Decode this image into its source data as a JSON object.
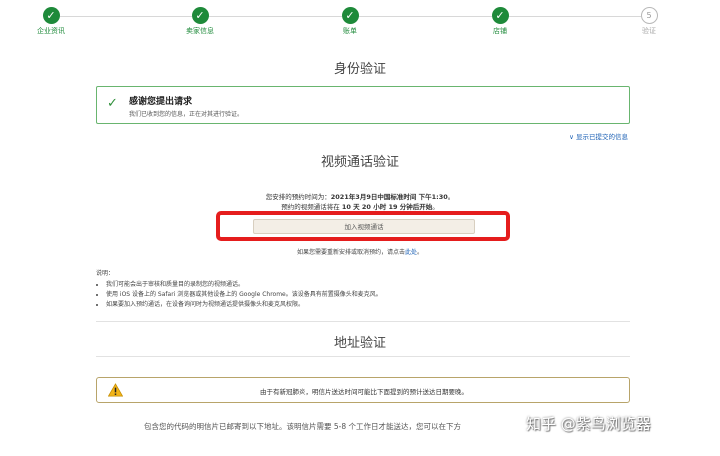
{
  "steps": [
    {
      "label": "企业资讯",
      "done": true,
      "icon": "check-icon"
    },
    {
      "label": "卖家信息",
      "done": true,
      "icon": "check-icon"
    },
    {
      "label": "账单",
      "done": true,
      "icon": "check-icon"
    },
    {
      "label": "店铺",
      "done": true,
      "icon": "check-icon"
    },
    {
      "label": "验证",
      "done": false,
      "number": "5"
    }
  ],
  "identity": {
    "title": "身份验证",
    "success_title": "感谢您提出请求",
    "success_message": "我们已收到您的信息，正在对其进行验证。",
    "show_info_link": "∨ 显示已提交的信息"
  },
  "video": {
    "title": "视频通话验证",
    "appt_prefix": "您安排的预约时间为：",
    "appt_time": "2021年3月9日中国标准时间 下午1:30",
    "appt_suffix": "。",
    "start_prefix": "预约的视频通话将在",
    "start_countdown": "10 天 20 小时 19 分钟后开始",
    "start_suffix": "。",
    "join_button": "加入视频通话",
    "reschedule_prefix": "如果您需要重新安排或取消预约，请点击",
    "reschedule_link": "此处",
    "reschedule_suffix": "。"
  },
  "notes": {
    "title": "说明：",
    "items": [
      "我们可能会出于审核和质量目的录制您的视频通话。",
      "使用 iOS 设备上的 Safari 浏览器或其他设备上的 Google Chrome。该设备具有前置摄像头和麦克风。",
      "如果要加入预约通话，在设备询问时为视频通话提供摄像头和麦克风权限。"
    ]
  },
  "address": {
    "title": "地址验证",
    "warning": "由于有新冠肺炎，明信片送达时间可能比下面提到的预计送达日期要晚。",
    "postcard_text": "包含您的代码的明信片已邮寄到以下地址。该明信片需要 5-8 个工作日才能送达，您可以在下方"
  },
  "watermark": "知乎 @紫鸟浏览器",
  "colors": {
    "success_green": "#1e8a3a",
    "highlight_red": "#e51d1d",
    "link_blue": "#1a5fb4",
    "warning_yellow": "#f2b418"
  }
}
